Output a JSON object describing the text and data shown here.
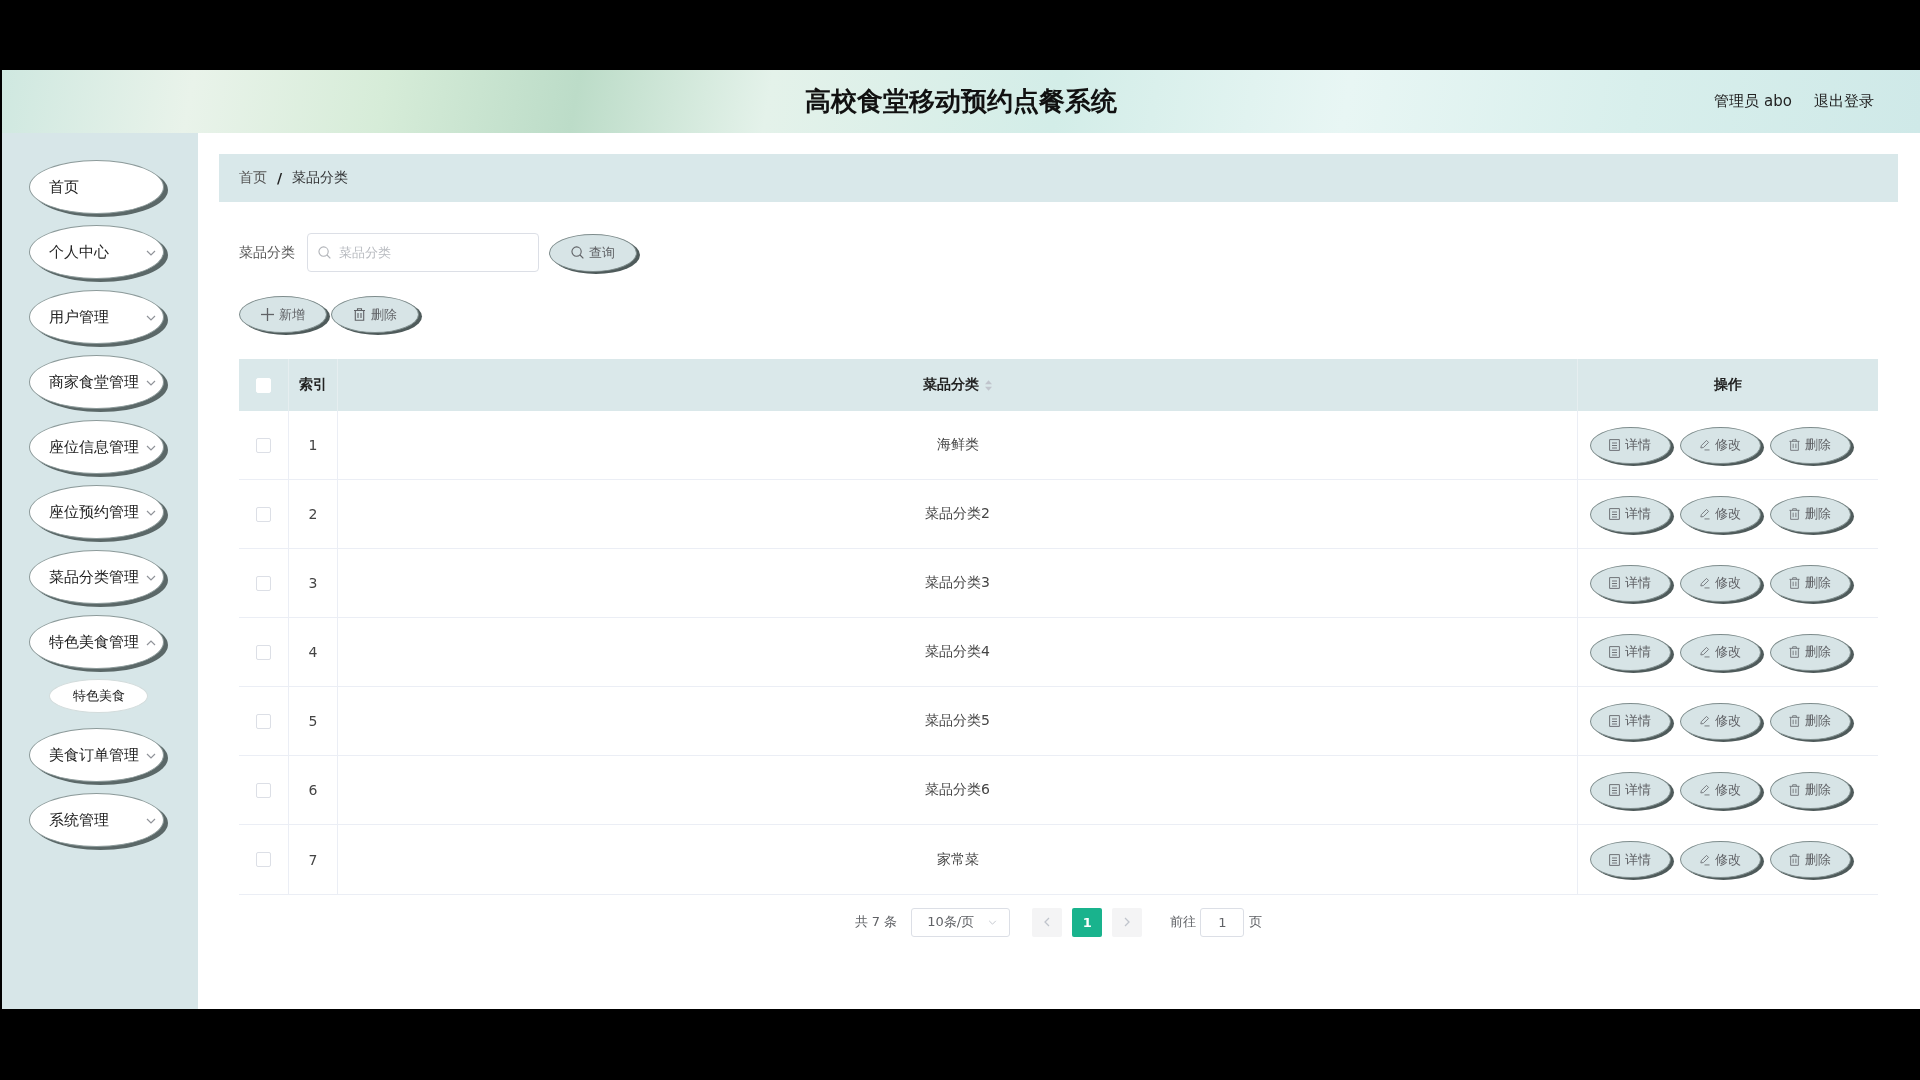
{
  "header": {
    "title": "高校食堂移动预约点餐系统",
    "user": "管理员 abo",
    "logout": "退出登录"
  },
  "sidebar": {
    "items": [
      {
        "label": "首页",
        "kind": "link"
      },
      {
        "label": "个人中心",
        "kind": "submenu",
        "expanded": false
      },
      {
        "label": "用户管理",
        "kind": "submenu",
        "expanded": false
      },
      {
        "label": "商家食堂管理",
        "kind": "submenu",
        "expanded": false
      },
      {
        "label": "座位信息管理",
        "kind": "submenu",
        "expanded": false
      },
      {
        "label": "座位预约管理",
        "kind": "submenu",
        "expanded": false
      },
      {
        "label": "菜品分类管理",
        "kind": "submenu",
        "expanded": false
      },
      {
        "label": "特色美食管理",
        "kind": "submenu",
        "expanded": true,
        "children": [
          {
            "label": "特色美食"
          }
        ]
      },
      {
        "label": "美食订单管理",
        "kind": "submenu",
        "expanded": false
      },
      {
        "label": "系统管理",
        "kind": "submenu",
        "expanded": false
      }
    ]
  },
  "breadcrumb": {
    "items": [
      "首页",
      "菜品分类"
    ],
    "separator": "/"
  },
  "search": {
    "label": "菜品分类",
    "placeholder": "菜品分类",
    "button": "查询"
  },
  "actions": [
    {
      "label": "新增",
      "kind": "add"
    },
    {
      "label": "删除",
      "kind": "delete"
    }
  ],
  "table": {
    "select_all": false,
    "columns": [
      {
        "label": "索引",
        "sortable": false
      },
      {
        "label": "菜品分类",
        "sortable": true
      },
      {
        "label": "操作",
        "sortable": false
      }
    ],
    "rows": [
      {
        "checked": false,
        "index": "1",
        "category": "海鲜类",
        "actions": [
          {
            "label": "详情",
            "kind": "detail"
          },
          {
            "label": "修改",
            "kind": "edit"
          },
          {
            "label": "删除",
            "kind": "delete"
          }
        ]
      },
      {
        "checked": false,
        "index": "2",
        "category": "菜品分类2",
        "actions": [
          {
            "label": "详情",
            "kind": "detail"
          },
          {
            "label": "修改",
            "kind": "edit"
          },
          {
            "label": "删除",
            "kind": "delete"
          }
        ]
      },
      {
        "checked": false,
        "index": "3",
        "category": "菜品分类3",
        "actions": [
          {
            "label": "详情",
            "kind": "detail"
          },
          {
            "label": "修改",
            "kind": "edit"
          },
          {
            "label": "删除",
            "kind": "delete"
          }
        ]
      },
      {
        "checked": false,
        "index": "4",
        "category": "菜品分类4",
        "actions": [
          {
            "label": "详情",
            "kind": "detail"
          },
          {
            "label": "修改",
            "kind": "edit"
          },
          {
            "label": "删除",
            "kind": "delete"
          }
        ]
      },
      {
        "checked": false,
        "index": "5",
        "category": "菜品分类5",
        "actions": [
          {
            "label": "详情",
            "kind": "detail"
          },
          {
            "label": "修改",
            "kind": "edit"
          },
          {
            "label": "删除",
            "kind": "delete"
          }
        ]
      },
      {
        "checked": false,
        "index": "6",
        "category": "菜品分类6",
        "actions": [
          {
            "label": "详情",
            "kind": "detail"
          },
          {
            "label": "修改",
            "kind": "edit"
          },
          {
            "label": "删除",
            "kind": "delete"
          }
        ]
      },
      {
        "checked": false,
        "index": "7",
        "category": "家常菜",
        "actions": [
          {
            "label": "详情",
            "kind": "detail"
          },
          {
            "label": "修改",
            "kind": "edit"
          },
          {
            "label": "删除",
            "kind": "delete"
          }
        ]
      }
    ]
  },
  "pagination": {
    "total": "共 7 条",
    "page_size": "10条/页",
    "prev": {
      "disabled": true
    },
    "pages": [
      {
        "label": "1",
        "selected": true
      }
    ],
    "next": {
      "disabled": true
    },
    "goto_label": "前往",
    "goto_value": "1",
    "goto_suffix": "页"
  }
}
